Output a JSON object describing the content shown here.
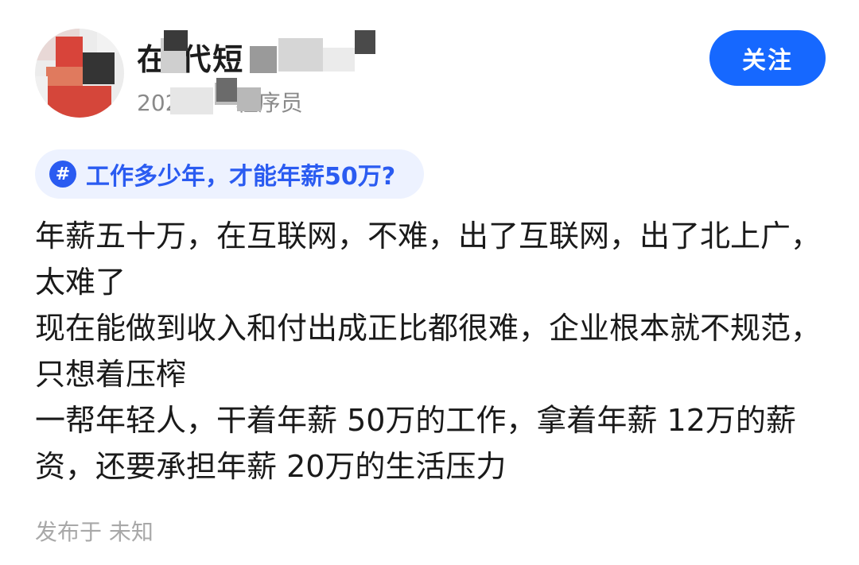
{
  "author": {
    "name": "在  代短",
    "meta": "202     30 · 程序员"
  },
  "follow_label": "关注",
  "topic": {
    "icon_glyph": "#",
    "label": "工作多少年，才能年薪50万?"
  },
  "post": {
    "paragraphs": [
      "年薪五十万，在互联网，不难，出了互联网，出了北上广，太难了",
      "现在能做到收入和付出成正比都很难，企业根本就不规范，只想着压榨",
      "一帮年轻人，干着年薪 50万的工作，拿着年薪 12万的薪资，还要承担年薪 20万的生活压力"
    ]
  },
  "footer": {
    "published": "发布于 未知"
  },
  "colors": {
    "accent": "#1668ff",
    "topic_bg": "#edf2ff",
    "topic_text": "#2a5bf1"
  }
}
